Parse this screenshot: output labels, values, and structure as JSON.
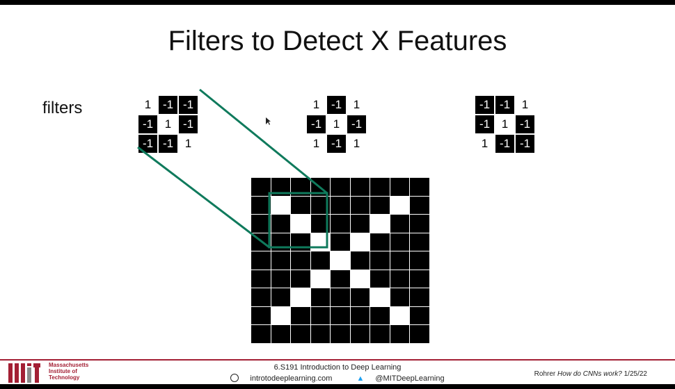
{
  "slide": {
    "title": "Filters to Detect X Features",
    "side_label": "filters"
  },
  "filters": [
    {
      "cells": [
        "1",
        "-1",
        "-1",
        "-1",
        "1",
        "-1",
        "-1",
        "-1",
        "1"
      ]
    },
    {
      "cells": [
        "1",
        "-1",
        "1",
        "-1",
        "1",
        "-1",
        "1",
        "-1",
        "1"
      ]
    },
    {
      "cells": [
        "-1",
        "-1",
        "1",
        "-1",
        "1",
        "-1",
        "1",
        "-1",
        "-1"
      ]
    }
  ],
  "image": {
    "rows": [
      [
        0,
        0,
        0,
        0,
        0,
        0,
        0,
        0,
        0
      ],
      [
        0,
        1,
        0,
        0,
        0,
        0,
        0,
        1,
        0
      ],
      [
        0,
        0,
        1,
        0,
        0,
        0,
        1,
        0,
        0
      ],
      [
        0,
        0,
        0,
        1,
        0,
        1,
        0,
        0,
        0
      ],
      [
        0,
        0,
        0,
        0,
        1,
        0,
        0,
        0,
        0
      ],
      [
        0,
        0,
        0,
        1,
        0,
        1,
        0,
        0,
        0
      ],
      [
        0,
        0,
        1,
        0,
        0,
        0,
        1,
        0,
        0
      ],
      [
        0,
        1,
        0,
        0,
        0,
        0,
        0,
        1,
        0
      ],
      [
        0,
        0,
        0,
        0,
        0,
        0,
        0,
        0,
        0
      ]
    ]
  },
  "colors": {
    "highlight": "#0f7a5c",
    "mit_red": "#a31f34",
    "twitter": "#1da1f2"
  },
  "footer": {
    "mit_line1": "Massachusetts",
    "mit_line2": "Institute of",
    "mit_line3": "Technology",
    "course": "6.S191 Introduction to Deep Learning",
    "website": "introtodeeplearning.com",
    "twitter": "@MITDeepLearning",
    "credit_author": "Rohrer",
    "credit_title": "How do CNNs work?",
    "credit_date": "1/25/22"
  }
}
